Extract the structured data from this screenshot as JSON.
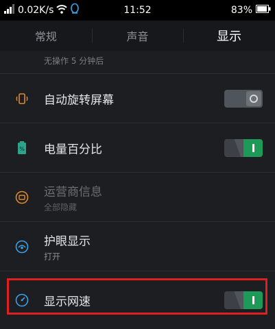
{
  "status_bar": {
    "speed": "0.02K/s",
    "time": "11:52",
    "battery": "83%"
  },
  "tabs": [
    {
      "label": "常规",
      "active": false
    },
    {
      "label": "声音",
      "active": false
    },
    {
      "label": "显示",
      "active": true
    }
  ],
  "settings": {
    "screen_timeout": {
      "subtitle": "无操作 5 分钟后"
    },
    "auto_rotate": {
      "title": "自动旋转屏幕",
      "enabled": false
    },
    "battery_percent": {
      "title": "电量百分比",
      "enabled": true
    },
    "carrier_info": {
      "title": "运营商信息",
      "subtitle": "全部隐藏"
    },
    "eye_protection": {
      "title": "护眼显示",
      "subtitle": "打开"
    },
    "network_speed": {
      "title": "显示网速",
      "enabled": true
    }
  },
  "colors": {
    "accent_green": "#1e9a58",
    "highlight_red": "#e02020",
    "icon_orange": "#e08a2a",
    "icon_teal": "#2aa58a",
    "icon_blue": "#3aa0e6"
  }
}
